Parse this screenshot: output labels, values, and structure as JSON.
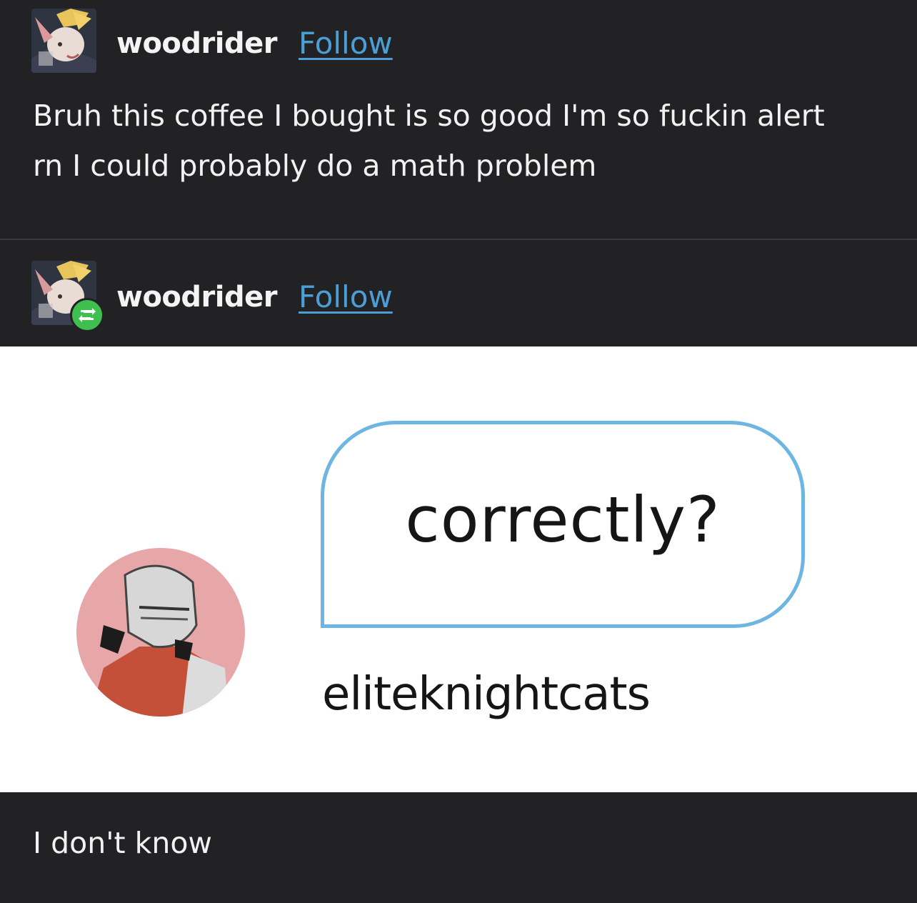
{
  "post1": {
    "username": "woodrider",
    "follow_label": "Follow",
    "text_line1": "Bruh this coffee I bought is so good I'm so fuckin alert",
    "text_line2": "rn I could probably do a math problem"
  },
  "post2": {
    "username": "woodrider",
    "follow_label": "Follow",
    "badge_icon": "reblog-icon",
    "image": {
      "bubble_text": "correctly?",
      "handle": "eliteknightcats"
    },
    "reply_text": "I don't know"
  },
  "colors": {
    "background": "#222224",
    "link": "#4c9fd6",
    "reblog_badge": "#3fbf4f",
    "bubble_border": "#6db6e2"
  }
}
